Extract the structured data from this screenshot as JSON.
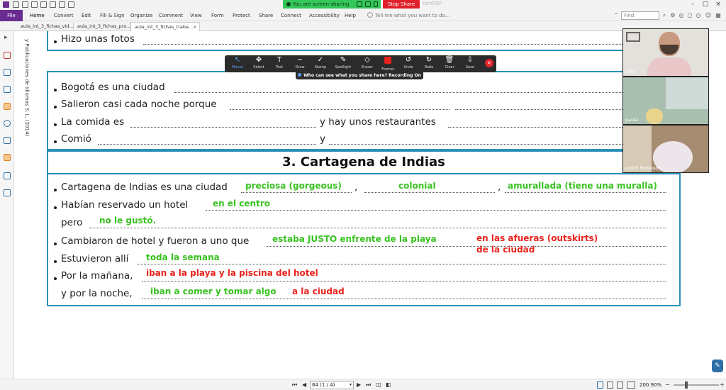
{
  "window": {
    "share_banner": "You are screen sharing",
    "stop_share": "Stop Share",
    "doc_title_ghost": "tomPDF",
    "controls": [
      "–",
      "□",
      "×"
    ]
  },
  "menu": {
    "file": "File",
    "items": [
      "Home",
      "Convert",
      "Edit",
      "Fill & Sign",
      "Organize",
      "Comment",
      "View",
      "Form",
      "Protect",
      "Share",
      "Connect",
      "Accessibility",
      "Help"
    ],
    "tell_me": "Tell me what you want to do...",
    "find_placeholder": "Find"
  },
  "tabs": [
    {
      "label": "aula_int_3_fichas_vid..."
    },
    {
      "label": "aula_int_3_fichas_pro..."
    },
    {
      "label": "aula_int_3_fichas_traba...",
      "active": true
    }
  ],
  "sidebar": {
    "icons": [
      "arrow-icon",
      "pages-icon",
      "layers-icon",
      "comments-icon",
      "attachment-icon",
      "fields-icon",
      "security-icon",
      "form-icon",
      "tools-icon"
    ]
  },
  "document": {
    "vertical_credit": "y Publicaciones de Idiomas S. L. (2014)",
    "row_hizo": "Hizo unas fotos",
    "row_bogota": "Bogotá es una ciudad",
    "row_salieron": "Salieron casi cada noche porque",
    "row_comida": "La comida es",
    "row_comida_mid": "y hay unos restaurantes",
    "row_comio": "Comió",
    "row_comio_mid": "y",
    "section_title": "3. Cartagena de Indias",
    "row_cartagena": "Cartagena de Indias es una ciudad",
    "row_cartagena_comma1": ",",
    "row_cartagena_comma2": ",",
    "row_habian": "Habían reservado un hotel",
    "row_pero": "pero",
    "row_cambiaron": "Cambiaron de hotel y fueron a uno que",
    "row_estuvieron": "Estuvieron allí",
    "row_manana": "Por la mañana,",
    "row_noche": "y por la noche,"
  },
  "answers": {
    "preciosa": "preciosa (gorgeous)",
    "colonial": "colonial",
    "amurallada": "amurallada (tiene una muralla)",
    "centro": "en el centro",
    "no_gusto": "no le gustó.",
    "justo": "estaba JUSTO enfrente de la playa",
    "afueras_1": "en las afueras (outskirts)",
    "afueras_2": "de la ciudad",
    "semana": "toda la semana",
    "playa_piscina": "iban a la playa y la piscina del hotel",
    "comer_tomar": "iban a comer y tomar algo",
    "a_la_ciudad": "a la ciudad"
  },
  "annotation_toolbar": {
    "tools": [
      {
        "label": "Mouse",
        "icon": "mouse-icon",
        "glyph": "↖",
        "selected": true
      },
      {
        "label": "Select",
        "icon": "select-icon",
        "glyph": "✥"
      },
      {
        "label": "Text",
        "icon": "text-icon",
        "glyph": "T"
      },
      {
        "label": "Draw",
        "icon": "draw-icon",
        "glyph": "∼"
      },
      {
        "label": "Stamp",
        "icon": "stamp-icon",
        "glyph": "✓"
      },
      {
        "label": "Spotlight",
        "icon": "spotlight-icon",
        "glyph": "✎"
      },
      {
        "label": "Eraser",
        "icon": "eraser-icon",
        "glyph": "◇"
      },
      {
        "label": "Format",
        "icon": "format-icon",
        "glyph": ""
      },
      {
        "label": "Undo",
        "icon": "undo-icon",
        "glyph": "↺"
      },
      {
        "label": "Redo",
        "icon": "redo-icon",
        "glyph": "↻"
      },
      {
        "label": "Clear",
        "icon": "clear-icon",
        "glyph": "🗑"
      },
      {
        "label": "Save",
        "icon": "save-icon",
        "glyph": "⇩"
      }
    ],
    "recording": "Who can see what you share here? Recording On"
  },
  "participants": [
    {
      "name": "Lolo"
    },
    {
      "name": "paula"
    },
    {
      "name": "Judith Robinson"
    }
  ],
  "status": {
    "page_field": "84 (1 / 4)",
    "zoom": "200.90%"
  },
  "colors": {
    "accent": "#6a2c91",
    "frame": "#2b8fb8",
    "answer_green": "#3ac222",
    "answer_red": "#e8231c",
    "share_green": "#34c759",
    "stop_red": "#e0202a"
  }
}
